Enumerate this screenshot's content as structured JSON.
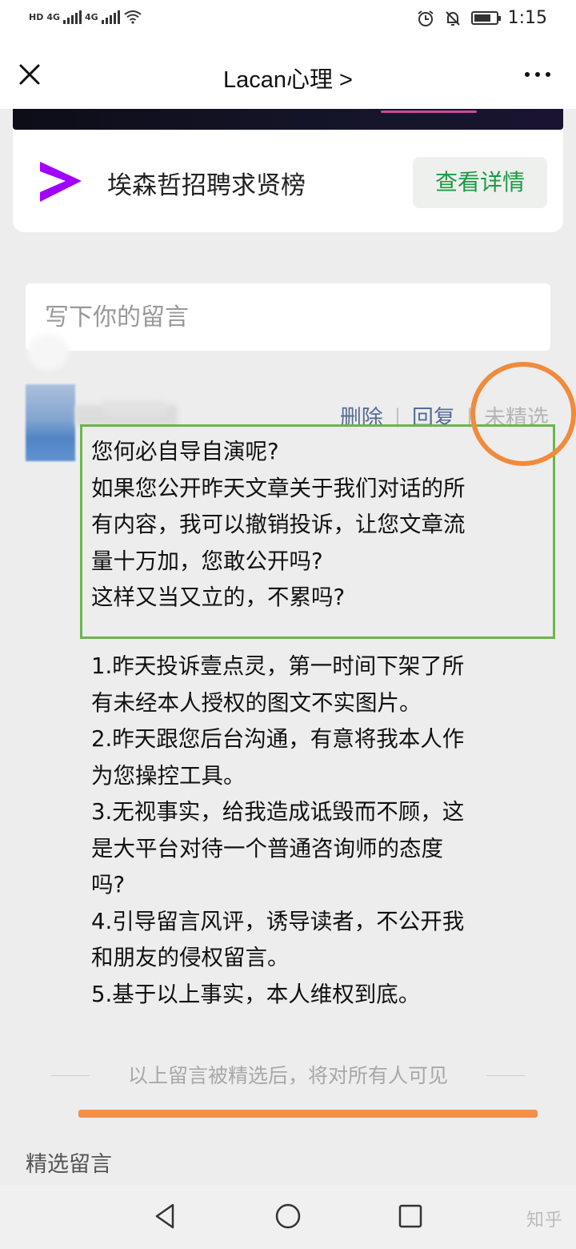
{
  "status_bar": {
    "network_tags": [
      "HD",
      "4G",
      "4G"
    ],
    "time": "1:15",
    "battery_level": 0.75
  },
  "nav": {
    "title": "Lacan心理 >",
    "icons": [
      "close-icon",
      "more-icon"
    ]
  },
  "ad_card": {
    "brand_icon": "accenture-logo-icon",
    "title": "埃森哲招聘求贤榜",
    "button_label": "查看详情",
    "accent_color": "#a100ff",
    "button_color": "#1d9a44"
  },
  "comment_input": {
    "placeholder": "写下你的留言"
  },
  "comment": {
    "actions": {
      "delete": "删除",
      "reply": "回复",
      "unselected": "未精选"
    },
    "highlighted_lines": [
      "您何必自导自演呢?",
      "如果您公开昨天文章关于我们对话的所",
      "有内容，我可以撤销投诉，让您文章流",
      "量十万加，您敢公开吗?",
      "这样又当又立的，不累吗?"
    ],
    "body_lines": [
      "1.昨天投诉壹点灵，第一时间下架了所",
      "有未经本人授权的图文不实图片。",
      "2.昨天跟您后台沟通，有意将我本人作",
      "为您操控工具。",
      "3.无视事实，给我造成诋毁而不顾，这",
      "是大平台对待一个普通咨询师的态度",
      "吗?",
      "4.引导留言风评，诱导读者，不公开我",
      "和朋友的侵权留言。",
      "5.基于以上事实，本人维权到底。"
    ]
  },
  "hint": "以上留言被精选后，将对所有人可见",
  "section_title": "精选留言",
  "watermark": "知乎",
  "colors": {
    "link_blue": "#576b95",
    "annotation_green": "#6ab64b",
    "annotation_orange": "#f08a3c"
  }
}
